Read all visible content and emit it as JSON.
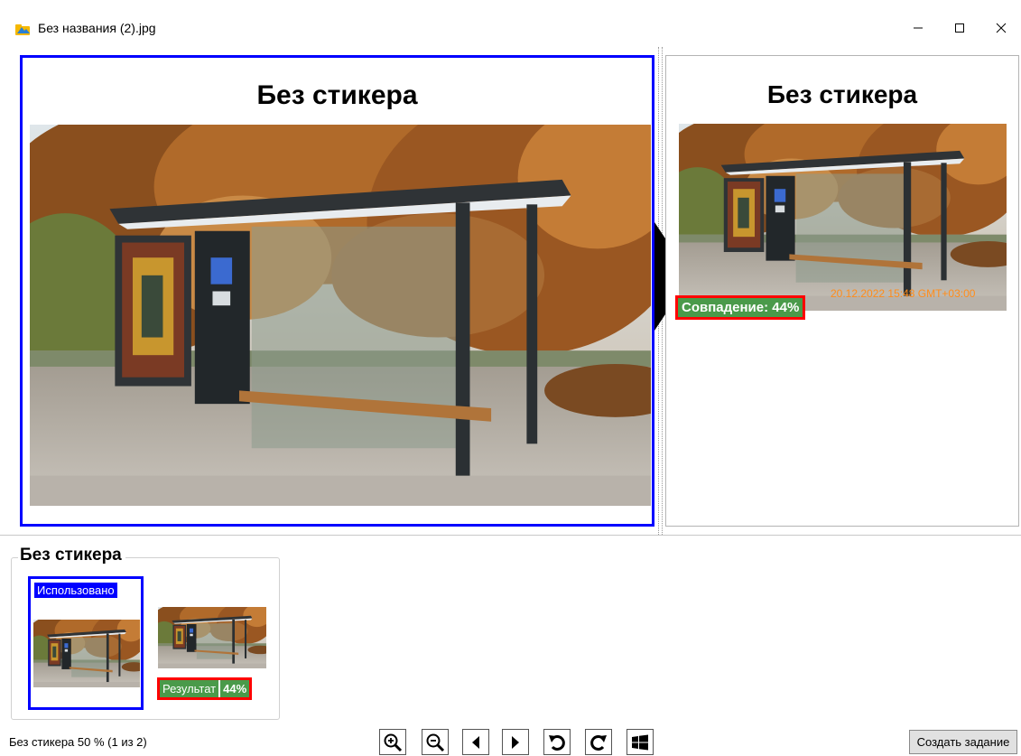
{
  "window": {
    "title": "Без названия (2).jpg"
  },
  "main_left": {
    "title": "Без стикера"
  },
  "main_right": {
    "title": "Без стикера",
    "timestamp": "20.12.2022 15:48 GMT+03:00",
    "match_label": "Совпадение: 44%"
  },
  "gallery": {
    "group_title": "Без стикера",
    "used_label": "Использовано",
    "result_label": "Результат",
    "result_percent": "44%"
  },
  "status": {
    "text": "Без стикера 50 % (1 из 2)"
  },
  "toolbar": {
    "icons": [
      "zoom-in-icon",
      "zoom-out-icon",
      "previous-icon",
      "next-icon",
      "rotate-left-icon",
      "rotate-right-icon",
      "windows-icon"
    ],
    "create_task_label": "Создать задание"
  },
  "colors": {
    "selection_border": "#0000ff",
    "match_border": "#ff0000",
    "match_background": "#4a9a4a",
    "timestamp": "#ff8c1a"
  }
}
